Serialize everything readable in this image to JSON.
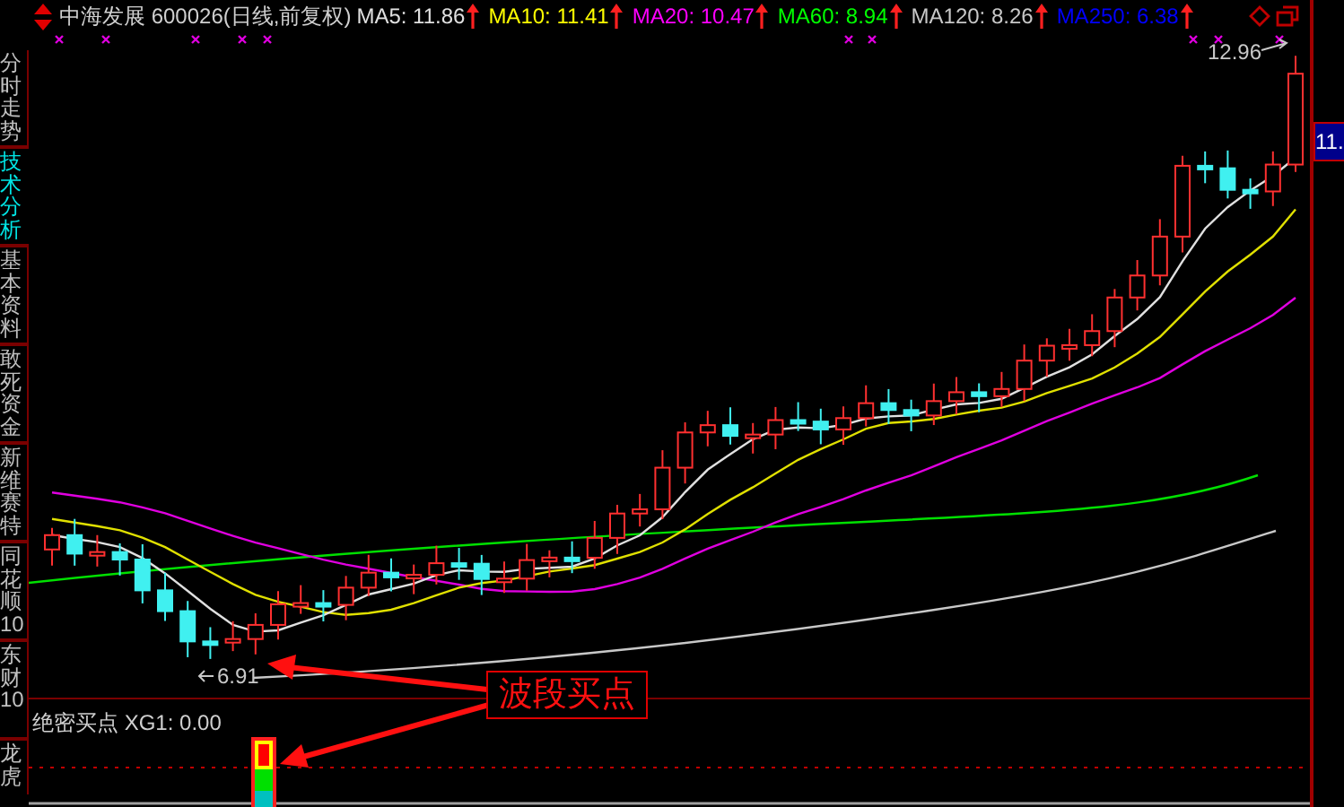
{
  "header": {
    "stock": "中海发展 600026(日线,前复权)",
    "indicators": [
      {
        "label": "MA5: 11.86",
        "color": "#e0e0e0"
      },
      {
        "label": "MA10: 11.41",
        "color": "#ffff00"
      },
      {
        "label": "MA20: 10.47",
        "color": "#ff00ff"
      },
      {
        "label": "MA60: 8.94",
        "color": "#00ff00"
      },
      {
        "label": "MA120: 8.26",
        "color": "#c8c8c8"
      },
      {
        "label": "MA250: 6.38",
        "color": "#0000ff"
      }
    ]
  },
  "sidebar": {
    "tabs": [
      {
        "label": "分时走势",
        "selected": false
      },
      {
        "label": "技术分析",
        "selected": true
      },
      {
        "label": "基本资料",
        "selected": false
      },
      {
        "label": "敢死资金",
        "selected": false
      },
      {
        "label": "新维赛特",
        "selected": false
      },
      {
        "label": "同花顺10",
        "selected": false
      },
      {
        "label": "东财10",
        "selected": false
      },
      {
        "label": "龙虎",
        "selected": false
      }
    ]
  },
  "chart": {
    "high_label": "12.96",
    "low_label": "6.91",
    "price_tag": "11.",
    "annotation": "波段买点"
  },
  "sub_chart": {
    "title": "绝密买点 XG1: 0.00"
  }
}
